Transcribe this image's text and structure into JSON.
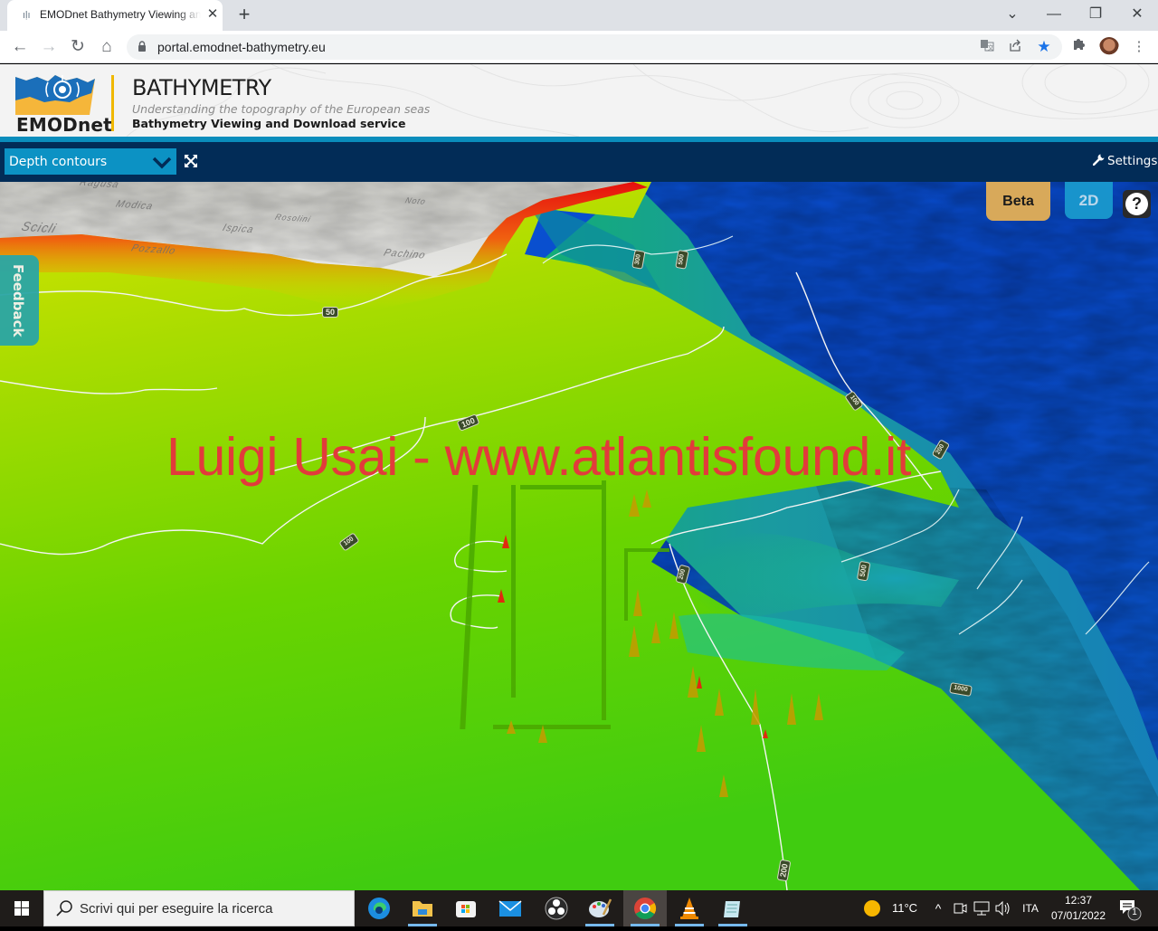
{
  "browser": {
    "tab": {
      "title": "EMODnet Bathymetry Viewing and Download service",
      "favicon": "emodnet-favicon"
    },
    "new_tab_label": "+",
    "window_controls": {
      "tab_search": "⌄",
      "minimize": "—",
      "restore": "❐",
      "close": "✕"
    },
    "nav": {
      "back": "←",
      "forward": "→",
      "reload": "↻",
      "home": "⌂"
    },
    "url": "portal.emodnet-bathymetry.eu",
    "omnibox_icons": [
      "translate-icon",
      "share-icon",
      "bookmark-star-icon"
    ],
    "toolbar_icons": [
      "extensions-icon",
      "profile-avatar",
      "menu-kebab-icon"
    ],
    "menu_label": "⋮",
    "accent_color": "#1a73e8"
  },
  "site": {
    "logo_text": "EMODnet",
    "title": "BATHYMETRY",
    "tagline": "Understanding the topography of the European seas",
    "subtitle": "Bathymetry Viewing and Download service",
    "colors": {
      "header_bg": "#f3f3f3",
      "accent_bar": "#0a8dbc",
      "toolbar_bg": "#022c57",
      "logo_yellow": "#f5b63a",
      "logo_blue": "#1b6fba"
    }
  },
  "app_toolbar": {
    "layer_select": {
      "value": "Depth contours"
    },
    "fullscreen_icon": "expand-arrows-icon",
    "settings_label": "Settings"
  },
  "map": {
    "mode": "3D",
    "place_names": [
      "Ragusa",
      "Modica",
      "Scicli",
      "Ispica",
      "Rosolini",
      "Pozzallo",
      "Noto",
      "Pachino"
    ],
    "contour_labels": [
      "50",
      "100",
      "100",
      "100",
      "200",
      "200",
      "200",
      "300",
      "500",
      "500",
      "1000"
    ],
    "watermark": "Luigi Usai - www.atlantisfound.it",
    "feedback_label": "Feedback",
    "beta_label": "Beta",
    "view_toggle_label": "2D",
    "help_label": "?",
    "depth_colors": {
      "land_shallow": "#e5120f",
      "shallow": "#e6e600",
      "shelf": "#5fd600",
      "slope": "#1a9a9a",
      "deep": "#0a45d0"
    }
  },
  "taskbar": {
    "search_placeholder": "Scrivi qui per eseguire la ricerca",
    "apps": [
      "edge",
      "file-explorer",
      "microsoft-store",
      "mail",
      "obs-studio",
      "paint",
      "chrome",
      "vlc",
      "notepad"
    ],
    "active_app": "chrome",
    "weather": "11°C",
    "tray_chevron": "^",
    "language": "ITA",
    "time": "12:37",
    "date": "07/01/2022",
    "notifications_count": "1"
  }
}
